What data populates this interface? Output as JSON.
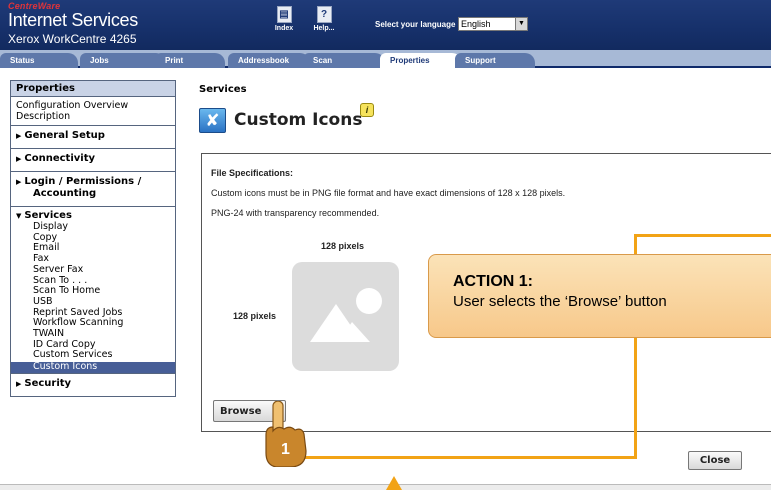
{
  "header": {
    "brand_small": "CentreWare",
    "brand": "Internet Services",
    "model": "Xerox WorkCentre 4265",
    "index_label": "Index",
    "help_label": "Help...",
    "language_label": "Select your language :",
    "language_value": "English"
  },
  "tabs": [
    {
      "label": "Status"
    },
    {
      "label": "Jobs"
    },
    {
      "label": "Print"
    },
    {
      "label": "Addressbook"
    },
    {
      "label": "Scan"
    },
    {
      "label": "Properties"
    },
    {
      "label": "Support"
    }
  ],
  "sidebar": {
    "title": "Properties",
    "config": "Configuration Overview Description",
    "general_setup": "General Setup",
    "connectivity": "Connectivity",
    "login_1": "Login / Permissions /",
    "login_2": "Accounting",
    "services": "Services",
    "service_items": [
      "Display",
      "Copy",
      "Email",
      "Fax",
      "Server Fax",
      "Scan To . . .",
      "Scan To Home",
      "USB",
      "Reprint Saved Jobs",
      "Workflow Scanning",
      "TWAIN",
      "ID Card Copy",
      "Custom Services"
    ],
    "selected_item": "Custom Icons",
    "security": "Security"
  },
  "main": {
    "section_label": "Services",
    "page_title": "Custom Icons",
    "spec_heading": "File Specifications:",
    "spec_line1": "Custom icons must be in PNG file format and have exact dimensions of 128 x 128 pixels.",
    "spec_line2": "PNG-24 with transparency recommended.",
    "dim_top": "128 pixels",
    "dim_left": "128 pixels",
    "browse_label": "Browse",
    "close_label": "Close"
  },
  "annotation": {
    "title": "ACTION 1:",
    "text": "User selects the ‘Browse’ button",
    "step": "1",
    "color": "#f2a316"
  }
}
